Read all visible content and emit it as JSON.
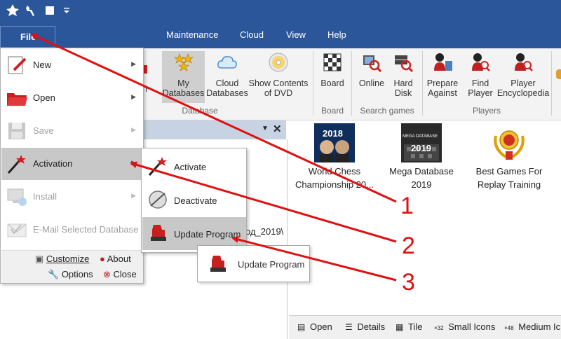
{
  "ribbon_tabs": [
    "Maintenance",
    "Cloud",
    "View",
    "Help"
  ],
  "file_tab_label": "File",
  "ribbon": {
    "my_databases": "My\nDatabases",
    "cloud_databases": "Cloud\nDatabases",
    "show_contents": "Show Contents\nof DVD",
    "partial_left": "en",
    "group_database": "Database",
    "board": "Board",
    "group_board": "Board",
    "online": "Online",
    "hard_disk": "Hard\nDisk",
    "group_search": "Search games",
    "prepare_against": "Prepare\nAgainst",
    "find_player": "Find\nPlayer",
    "player_encyclopedia": "Player\nEncyclopedia",
    "group_players": "Players"
  },
  "file_menu": {
    "items": [
      {
        "label": "New",
        "has_arrow": true,
        "disabled": false
      },
      {
        "label": "Open",
        "has_arrow": true,
        "disabled": false
      },
      {
        "label": "Save",
        "has_arrow": true,
        "disabled": true
      },
      {
        "label": "Activation",
        "has_arrow": true,
        "disabled": false
      },
      {
        "label": "Install",
        "has_arrow": true,
        "disabled": true
      },
      {
        "label": "E-Mail Selected Database",
        "has_arrow": false,
        "disabled": true
      }
    ],
    "customize": "Customize",
    "about": "About",
    "options": "Options",
    "close": "Close"
  },
  "submenu": {
    "activate": "Activate",
    "deactivate": "Deactivate",
    "update_program": "Update Program"
  },
  "tooltip": "Update Program",
  "left_pane": {
    "partial_text": "од_2019\\"
  },
  "databases": [
    {
      "badge": "2018",
      "label": "World Chess\nChampionship 20..."
    },
    {
      "badge": "2019",
      "label": "Mega Database\n2019"
    },
    {
      "badge": "",
      "label": "Best Games For\nReplay Training"
    }
  ],
  "mega_badge_top": "MEGA DATABASE",
  "bottom_bar": {
    "open": "Open",
    "details": "Details",
    "tile": "Tile",
    "small_icons_prefix": "×32",
    "small_icons": "Small Icons",
    "medium_icons_prefix": "×48",
    "medium_icons": "Medium Ic"
  },
  "callouts": [
    "1",
    "2",
    "3"
  ],
  "colors": {
    "accent": "#2b579a",
    "annotation": "#e01010"
  }
}
